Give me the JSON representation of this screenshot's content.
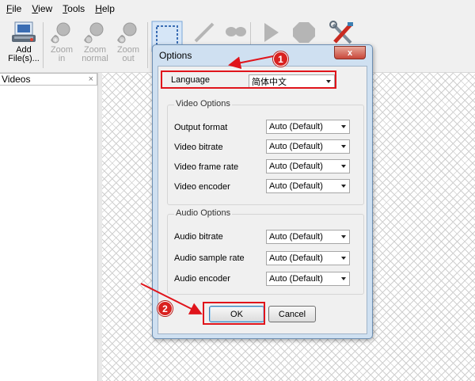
{
  "menu": [
    "File",
    "View",
    "Tools",
    "Help"
  ],
  "menu_underline": [
    "F",
    "V",
    "T",
    "H"
  ],
  "toolbar": {
    "add": "Add\nFile(s)...",
    "zoom_in": "Zoom\nin",
    "zoom_normal": "Zoom\nnormal",
    "zoom_out": "Zoom\nout"
  },
  "left_panel": {
    "title": "Videos",
    "close": "×"
  },
  "dialog": {
    "title": "Options",
    "close": "x",
    "language_label": "Language",
    "language_value": "简体中文",
    "video_group": "Video Options",
    "video_rows": [
      {
        "label": "Output format",
        "value": "Auto (Default)"
      },
      {
        "label": "Video bitrate",
        "value": "Auto (Default)"
      },
      {
        "label": "Video frame rate",
        "value": "Auto (Default)"
      },
      {
        "label": "Video encoder",
        "value": "Auto (Default)"
      }
    ],
    "audio_group": "Audio Options",
    "audio_rows": [
      {
        "label": "Audio bitrate",
        "value": "Auto (Default)"
      },
      {
        "label": "Audio sample rate",
        "value": "Auto (Default)"
      },
      {
        "label": "Audio encoder",
        "value": "Auto (Default)"
      }
    ],
    "ok": "OK",
    "cancel": "Cancel"
  },
  "annotations": {
    "badge1": "1",
    "badge2": "2"
  },
  "colors": {
    "annotation_red": "#e0141b",
    "dialog_frame": "#cfe0f1",
    "accent_blue": "#3c7fb1"
  }
}
